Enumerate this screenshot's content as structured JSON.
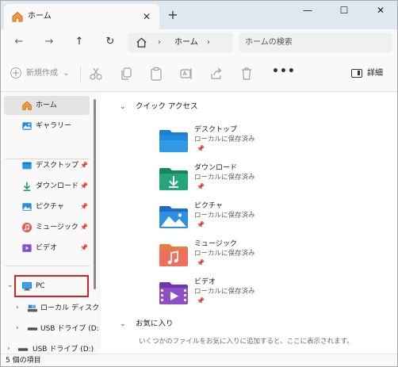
{
  "window": {
    "tab_title": "ホーム",
    "tab_close_glyph": "✕",
    "new_tab_glyph": "+",
    "controls": {
      "minimize": "—",
      "maximize": "☐",
      "close": "✕"
    }
  },
  "nav": {
    "back_glyph": "←",
    "forward_glyph": "→",
    "up_glyph": "↑",
    "refresh_glyph": "↻",
    "breadcrumb": "ホーム",
    "separator": "›",
    "search_placeholder": "ホームの検索"
  },
  "toolbar": {
    "new_label": "新規作成",
    "new_glyph": "+",
    "new_dropdown_glyph": "⌄",
    "more_glyph": "•••",
    "details_label": "詳細",
    "icons": [
      "cut-icon",
      "copy-icon",
      "paste-icon",
      "rename-icon",
      "share-icon",
      "delete-icon"
    ]
  },
  "sidebar": {
    "items": [
      {
        "label": "ホーム",
        "icon": "home-icon",
        "selected": true
      },
      {
        "label": "ギャラリー",
        "icon": "gallery-icon"
      },
      {
        "label": "デスクトップ",
        "icon": "desktop-icon",
        "pin": "📌"
      },
      {
        "label": "ダウンロード",
        "icon": "download-icon",
        "pin": "📌"
      },
      {
        "label": "ピクチャ",
        "icon": "pictures-icon",
        "pin": "📌"
      },
      {
        "label": "ミュージック",
        "icon": "music-icon",
        "pin": "📌"
      },
      {
        "label": "ビデオ",
        "icon": "videos-icon",
        "pin": "📌"
      },
      {
        "label": "PC",
        "icon": "pc-icon",
        "expanded": true
      },
      {
        "label": "ローカル ディスク",
        "icon": "local-disk-icon"
      },
      {
        "label": "USB ドライブ (D:",
        "icon": "usb-drive-icon"
      },
      {
        "label": "USB ドライブ (D:)",
        "icon": "usb-drive-icon"
      }
    ],
    "chevron_down": "⌄",
    "chevron_right": "›"
  },
  "main": {
    "quick_access": {
      "title": "クイック アクセス",
      "items": [
        {
          "name": "デスクトップ",
          "sub": "ローカルに保存済み",
          "icon": "desktop-folder-icon",
          "color": "#1f7fd6"
        },
        {
          "name": "ダウンロード",
          "sub": "ローカルに保存済み",
          "icon": "downloads-folder-icon",
          "color": "#1f9b72"
        },
        {
          "name": "ピクチャ",
          "sub": "ローカルに保存済み",
          "icon": "pictures-folder-icon",
          "color": "#1f87d9"
        },
        {
          "name": "ミュージック",
          "sub": "ローカルに保存済み",
          "icon": "music-folder-icon",
          "color": "#e96a55"
        },
        {
          "name": "ビデオ",
          "sub": "ローカルに保存済み",
          "icon": "videos-folder-icon",
          "color": "#8d4fc7"
        }
      ],
      "pin_glyph": "📌"
    },
    "favorites": {
      "title": "お気に入り",
      "note": "いくつかのファイルをお気に入りに追加すると、ここに表示されます。"
    }
  },
  "status": {
    "item_count": "5 個の項目"
  },
  "colors": {
    "highlight": "#d4202a",
    "titlebar": "#dfe7f0"
  }
}
